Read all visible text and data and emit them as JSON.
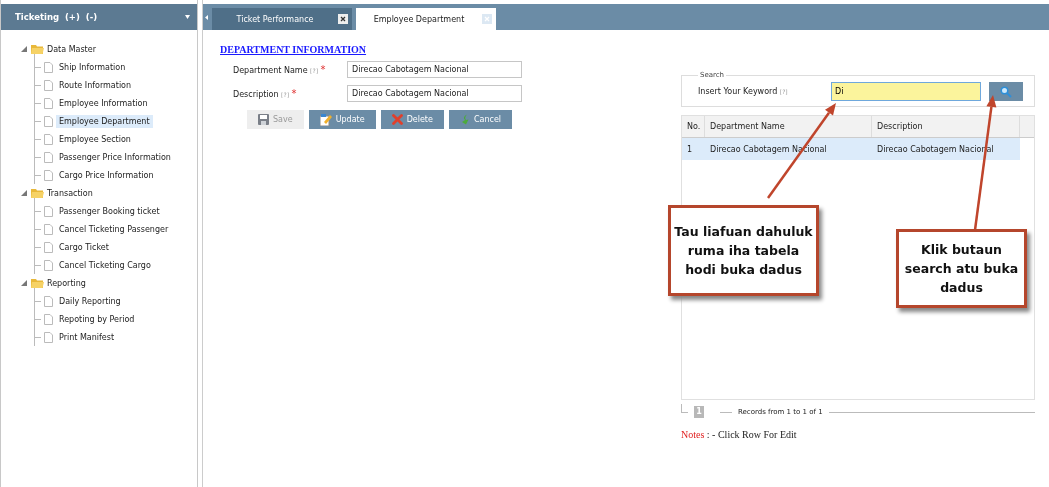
{
  "sidebar": {
    "title": "Ticketing  (+)  (-)",
    "tree": [
      {
        "label": "Data Master",
        "expanded": true,
        "children": [
          {
            "label": "Ship Information",
            "selected": false
          },
          {
            "label": "Route Information",
            "selected": false
          },
          {
            "label": "Employee Information",
            "selected": false
          },
          {
            "label": "Employee Department",
            "selected": true
          },
          {
            "label": "Employee Section",
            "selected": false
          },
          {
            "label": "Passenger Price Information",
            "selected": false
          },
          {
            "label": "Cargo Price Information",
            "selected": false
          }
        ]
      },
      {
        "label": "Transaction",
        "expanded": true,
        "children": [
          {
            "label": "Passenger Booking ticket",
            "selected": false
          },
          {
            "label": "Cancel Ticketing Passenger",
            "selected": false
          },
          {
            "label": "Cargo Ticket",
            "selected": false
          },
          {
            "label": "Cancel Ticketing Cargo",
            "selected": false
          }
        ]
      },
      {
        "label": "Reporting",
        "expanded": true,
        "children": [
          {
            "label": "Daily Reporting",
            "selected": false
          },
          {
            "label": "Repoting by Period",
            "selected": false
          },
          {
            "label": "Print Manifest",
            "selected": false
          }
        ]
      }
    ]
  },
  "tabs": [
    {
      "label": "Ticket Performance",
      "selected": false
    },
    {
      "label": "Employee Department",
      "selected": true
    }
  ],
  "form": {
    "heading": "DEPARTMENT INFORMATION",
    "fields": [
      {
        "label": "Department Name",
        "hint": "[?]",
        "required_mark": "*",
        "value": "Direcao Cabotagem Nacional"
      },
      {
        "label": "Description",
        "hint": "[?]",
        "required_mark": "*",
        "value": "Direcao Cabotagem Nacional"
      }
    ],
    "buttons": [
      {
        "label": "Save",
        "kind": "save",
        "disabled": true
      },
      {
        "label": "Update",
        "kind": "update",
        "disabled": false
      },
      {
        "label": "Delete",
        "kind": "delete",
        "disabled": false
      },
      {
        "label": "Cancel",
        "kind": "cancel",
        "disabled": false
      }
    ]
  },
  "search": {
    "legend": "Search",
    "label": "Insert Your Keyword",
    "hint": "[?]",
    "value": "Di"
  },
  "table": {
    "columns": [
      "No.",
      "Department Name",
      "Description"
    ],
    "rows": [
      {
        "cells": [
          "1",
          "Direcao Cabotagem Nacional",
          "Direcao Cabotagem Nacional"
        ],
        "selected": true
      }
    ]
  },
  "pager": {
    "page": "1",
    "records": "Records from 1 to 1 of 1"
  },
  "notes": {
    "label": "Notes",
    "text": ": - Click Row For Edit"
  },
  "callouts": [
    {
      "lines": [
        "Tau liafuan dahuluk",
        "ruma iha tabela",
        "hodi buka dadus"
      ]
    },
    {
      "lines": [
        "Klik butaun",
        "search atu buka",
        "dadus"
      ]
    }
  ]
}
